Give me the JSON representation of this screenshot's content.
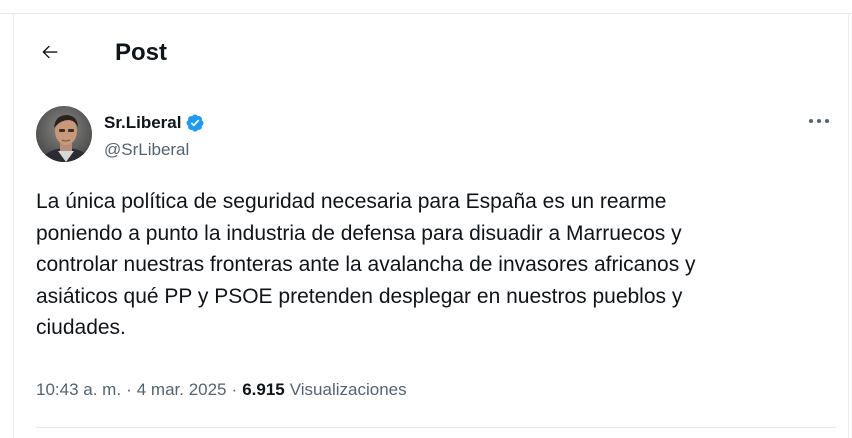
{
  "header": {
    "back_icon": "arrow-left-icon",
    "title": "Post"
  },
  "author": {
    "display_name": "Sr.Liberal",
    "handle": "@SrLiberal",
    "verified_icon": "verified-badge-icon",
    "verified_color": "#1d9bf0",
    "more_icon": "more-horizontal-icon"
  },
  "tweet": {
    "text": "La única política de seguridad necesaria para España es un rearme\nponiendo a punto la industria de defensa para disuadir a Marruecos y\ncontrolar nuestras fronteras ante la avalancha de invasores africanos y\nasiáticos qué PP y PSOE pretenden desplegar en nuestros pueblos y\nciudades."
  },
  "meta": {
    "time": "10:43 a. m.",
    "separator": "·",
    "date": "4 mar. 2025",
    "views_count": "6.915",
    "views_label": "Visualizaciones"
  },
  "colors": {
    "text_primary": "#0f1419",
    "text_secondary": "#536471",
    "border": "#e6e9eb"
  }
}
